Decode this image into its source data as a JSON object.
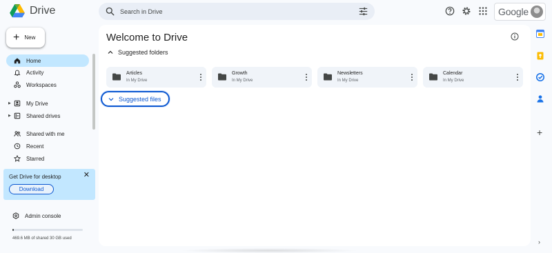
{
  "app": {
    "title": "Drive",
    "brand": "Google"
  },
  "search": {
    "placeholder": "Search in Drive"
  },
  "header_icons": [
    "help-icon",
    "gear-icon",
    "apps-icon",
    "tune-icon"
  ],
  "new_button": {
    "label": "New"
  },
  "sidebar": {
    "items": [
      {
        "label": "Home",
        "icon": "home-icon",
        "active": true
      },
      {
        "label": "Activity",
        "icon": "bell-icon"
      },
      {
        "label": "Workspaces",
        "icon": "workspaces-icon"
      },
      {
        "label": "My Drive",
        "icon": "my-drive-icon",
        "expandable": true
      },
      {
        "label": "Shared drives",
        "icon": "shared-drives-icon",
        "expandable": true
      },
      {
        "label": "Shared with me",
        "icon": "people-icon"
      },
      {
        "label": "Recent",
        "icon": "clock-icon"
      },
      {
        "label": "Starred",
        "icon": "star-icon"
      }
    ]
  },
  "promo": {
    "title": "Get Drive for desktop",
    "button": "Download"
  },
  "admin": {
    "label": "Admin console"
  },
  "storage": {
    "text": "469.6 MB of shared 30 GB used",
    "fraction": 0.016
  },
  "main": {
    "title": "Welcome to Drive",
    "suggested_folders_label": "Suggested folders",
    "folders": [
      {
        "name": "Articles",
        "location": "In My Drive"
      },
      {
        "name": "Growth",
        "location": "In My Drive"
      },
      {
        "name": "Newsletters",
        "location": "In My Drive"
      },
      {
        "name": "Calendar",
        "location": "In My Drive"
      }
    ],
    "suggested_files_label": "Suggested files"
  },
  "colors": {
    "accent": "#0b57d0",
    "active_nav": "#c2e7ff",
    "background": "#f8fafd",
    "card": "#f0f4f9"
  }
}
